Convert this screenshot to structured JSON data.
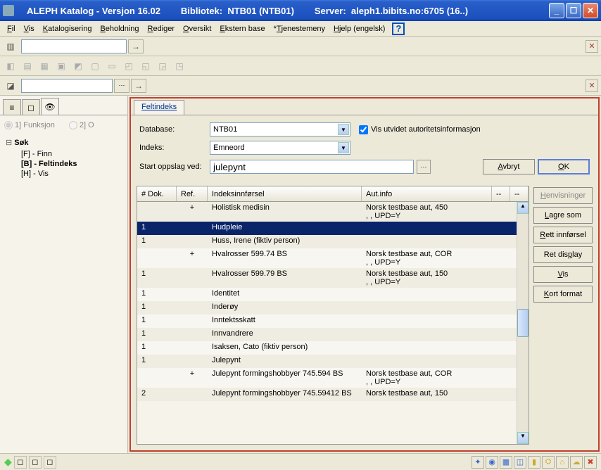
{
  "titlebar": {
    "app": "ALEPH Katalog - Versjon 16.02",
    "library": "Bibliotek:  NTB01 (NTB01)",
    "server": "Server:  aleph1.bibits.no:6705 (16..)"
  },
  "menu": {
    "fil": "Fil",
    "vis": "Vis",
    "katalogisering": "Katalogisering",
    "beholdning": "Beholdning",
    "rediger": "Rediger",
    "oversikt": "Oversikt",
    "ekstern": "Ekstern base",
    "tjenestemeny": "*Tjenestemeny",
    "hjelp": "Hjelp (engelsk)"
  },
  "left": {
    "radio1": "1] Funksjon",
    "radio2": "2] O",
    "tree_root": "Søk",
    "tree_f": "[F] - Finn",
    "tree_b": "[B] - Feltindeks",
    "tree_h": "[H] - Vis"
  },
  "right": {
    "tab": "Feltindeks",
    "label_db": "Database:",
    "db_value": "NTB01",
    "label_index": "Indeks:",
    "index_value": "Emneord",
    "checkbox": "Vis utvidet autoritetsinformasjon",
    "label_start": "Start oppslag ved:",
    "start_value": "julepynt",
    "btn_cancel": "Avbryt",
    "btn_ok": "OK"
  },
  "table": {
    "headers": {
      "c0": "# Dok.",
      "c1": "Ref.",
      "c2": "Indeksinnførsel",
      "c3": "Aut.info",
      "c4": "--",
      "c5": "--"
    },
    "rows": [
      {
        "dok": "",
        "ref": "+",
        "entry": "Holistisk medisin",
        "aut": "Norsk testbase aut, 450\n, , UPD=Y",
        "cls": "odd"
      },
      {
        "dok": "1",
        "ref": "",
        "entry": "Hudpleie",
        "aut": "",
        "cls": "selected"
      },
      {
        "dok": "1",
        "ref": "",
        "entry": "Huss, Irene (fiktiv person)",
        "aut": "",
        "cls": "odd"
      },
      {
        "dok": "",
        "ref": "+",
        "entry": "Hvalrosser 599.74 BS",
        "aut": "Norsk testbase aut, COR\n, , UPD=Y",
        "cls": "even"
      },
      {
        "dok": "1",
        "ref": "",
        "entry": "Hvalrosser 599.79 BS",
        "aut": "Norsk testbase aut, 150\n, , UPD=Y",
        "cls": "odd"
      },
      {
        "dok": "1",
        "ref": "",
        "entry": "Identitet",
        "aut": "",
        "cls": "even"
      },
      {
        "dok": "1",
        "ref": "",
        "entry": "Inderøy",
        "aut": "",
        "cls": "odd"
      },
      {
        "dok": "1",
        "ref": "",
        "entry": "Inntektsskatt",
        "aut": "",
        "cls": "even"
      },
      {
        "dok": "1",
        "ref": "",
        "entry": "Innvandrere",
        "aut": "",
        "cls": "odd"
      },
      {
        "dok": "1",
        "ref": "",
        "entry": "Isaksen, Cato (fiktiv person)",
        "aut": "",
        "cls": "even"
      },
      {
        "dok": "1",
        "ref": "",
        "entry": "Julepynt",
        "aut": "",
        "cls": "odd"
      },
      {
        "dok": "",
        "ref": "+",
        "entry": "Julepynt formingshobbyer 745.594 BS",
        "aut": "Norsk testbase aut, COR\n, , UPD=Y",
        "cls": "even"
      },
      {
        "dok": "2",
        "ref": "",
        "entry": "Julepynt formingshobbyer 745.59412 BS",
        "aut": "Norsk testbase aut, 150",
        "cls": "odd"
      }
    ]
  },
  "side": {
    "henv": "Henvisninger",
    "lagre": "Lagre som",
    "rett": "Rett innførsel",
    "retd": "Ret display",
    "vis": "Vis",
    "kort": "Kort format"
  }
}
